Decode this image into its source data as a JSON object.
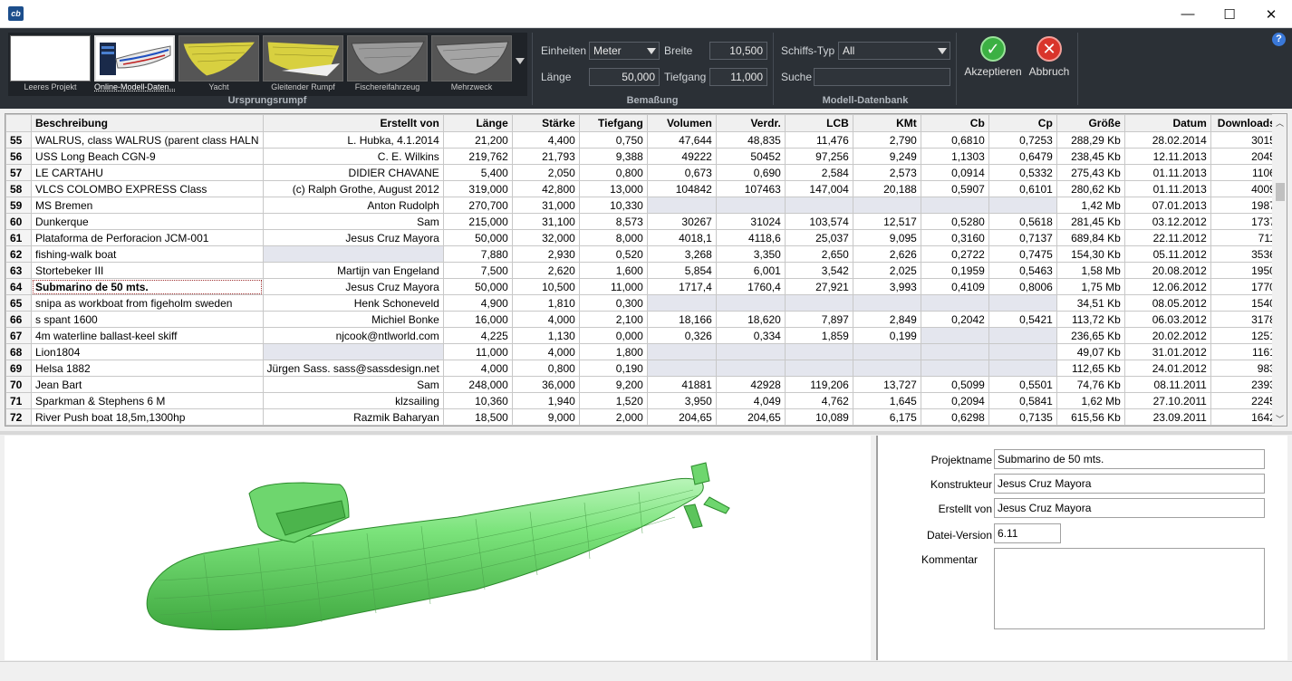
{
  "window": {
    "title_icon": "cb-logo-icon",
    "minimize": "—",
    "maximize": "☐",
    "close": "✕"
  },
  "ribbon": {
    "thumbnails": [
      {
        "label": "Leeres Projekt",
        "selected": false
      },
      {
        "label": "Online-Modell-Daten...",
        "selected": true
      },
      {
        "label": "Yacht",
        "selected": false
      },
      {
        "label": "Gleitender Rumpf",
        "selected": false
      },
      {
        "label": "Fischereifahrzeug",
        "selected": false
      },
      {
        "label": "Mehrzweck",
        "selected": false
      }
    ],
    "group_ursprung": "Ursprungsrumpf",
    "einheiten_label": "Einheiten",
    "einheiten_value": "Meter",
    "breite_label": "Breite",
    "breite_value": "10,500",
    "laenge_label": "Länge",
    "laenge_value": "50,000",
    "tiefgang_label": "Tiefgang",
    "tiefgang_value": "11,000",
    "group_bemassung": "Bemaßung",
    "schiffstyp_label": "Schiffs-Typ",
    "schiffstyp_value": "All",
    "suche_label": "Suche",
    "suche_value": "",
    "group_datenbank": "Modell-Datenbank",
    "accept_label": "Akzeptieren",
    "cancel_label": "Abbruch",
    "help_icon": "?"
  },
  "grid": {
    "columns": [
      "",
      "Beschreibung",
      "Erstellt von",
      "Länge",
      "Stärke",
      "Tiefgang",
      "Volumen",
      "Verdr.",
      "LCB",
      "KMt",
      "Cb",
      "Cp",
      "Größe",
      "Datum",
      "Downloads"
    ],
    "rows": [
      [
        "55",
        "WALRUS, class WALRUS (parent class HALN",
        "L. Hubka, 4.1.2014",
        "21,200",
        "4,400",
        "0,750",
        "47,644",
        "48,835",
        "11,476",
        "2,790",
        "0,6810",
        "0,7253",
        "288,29 Kb",
        "28.02.2014",
        "3015"
      ],
      [
        "56",
        "USS Long Beach CGN-9",
        "C. E. Wilkins",
        "219,762",
        "21,793",
        "9,388",
        "49222",
        "50452",
        "97,256",
        "9,249",
        "1,1303",
        "0,6479",
        "238,45 Kb",
        "12.11.2013",
        "2045"
      ],
      [
        "57",
        "LE CARTAHU",
        "DIDIER CHAVANE",
        "5,400",
        "2,050",
        "0,800",
        "0,673",
        "0,690",
        "2,584",
        "2,573",
        "0,0914",
        "0,5332",
        "275,43 Kb",
        "01.11.2013",
        "1106"
      ],
      [
        "58",
        "VLCS  COLOMBO EXPRESS Class",
        "(c) Ralph Grothe, August 2012",
        "319,000",
        "42,800",
        "13,000",
        "104842",
        "107463",
        "147,004",
        "20,188",
        "0,5907",
        "0,6101",
        "280,62 Kb",
        "01.11.2013",
        "4009"
      ],
      [
        "59",
        "MS Bremen",
        "Anton Rudolph",
        "270,700",
        "31,000",
        "10,330",
        "",
        "",
        "",
        "",
        "",
        "",
        "1,42 Mb",
        "07.01.2013",
        "1987"
      ],
      [
        "60",
        "Dunkerque",
        "Sam",
        "215,000",
        "31,100",
        "8,573",
        "30267",
        "31024",
        "103,574",
        "12,517",
        "0,5280",
        "0,5618",
        "281,45 Kb",
        "03.12.2012",
        "1737"
      ],
      [
        "61",
        "Plataforma de Perforacion JCM-001",
        "Jesus Cruz Mayora",
        "50,000",
        "32,000",
        "8,000",
        "4018,1",
        "4118,6",
        "25,037",
        "9,095",
        "0,3160",
        "0,7137",
        "689,84 Kb",
        "22.11.2012",
        "711"
      ],
      [
        "62",
        "fishing-walk boat",
        "",
        "7,880",
        "2,930",
        "0,520",
        "3,268",
        "3,350",
        "2,650",
        "2,626",
        "0,2722",
        "0,7475",
        "154,30 Kb",
        "05.11.2012",
        "3536"
      ],
      [
        "63",
        "Stortebeker III",
        "Martijn van Engeland",
        "7,500",
        "2,620",
        "1,600",
        "5,854",
        "6,001",
        "3,542",
        "2,025",
        "0,1959",
        "0,5463",
        "1,58 Mb",
        "20.08.2012",
        "1950"
      ],
      [
        "64",
        "Submarino de 50 mts.",
        "Jesus Cruz Mayora",
        "50,000",
        "10,500",
        "11,000",
        "1717,4",
        "1760,4",
        "27,921",
        "3,993",
        "0,4109",
        "0,8006",
        "1,75 Mb",
        "12.06.2012",
        "1770"
      ],
      [
        "65",
        "snipa as workboat from figeholm sweden",
        "Henk Schoneveld",
        "4,900",
        "1,810",
        "0,300",
        "",
        "",
        "",
        "",
        "",
        "",
        "34,51 Kb",
        "08.05.2012",
        "1540"
      ],
      [
        "66",
        "s spant 1600",
        "Michiel Bonke",
        "16,000",
        "4,000",
        "2,100",
        "18,166",
        "18,620",
        "7,897",
        "2,849",
        "0,2042",
        "0,5421",
        "113,72 Kb",
        "06.03.2012",
        "3178"
      ],
      [
        "67",
        "4m waterline ballast-keel skiff",
        "njcook@ntlworld.com",
        "4,225",
        "1,130",
        "0,000",
        "0,326",
        "0,334",
        "1,859",
        "0,199",
        "",
        "",
        "236,65 Kb",
        "20.02.2012",
        "1251"
      ],
      [
        "68",
        "Lion1804",
        "",
        "11,000",
        "4,000",
        "1,800",
        "",
        "",
        "",
        "",
        "",
        "",
        "49,07 Kb",
        "31.01.2012",
        "1161"
      ],
      [
        "69",
        "Helsa 1882",
        "Jürgen Sass. sass@sassdesign.net",
        "4,000",
        "0,800",
        "0,190",
        "",
        "",
        "",
        "",
        "",
        "",
        "112,65 Kb",
        "24.01.2012",
        "983"
      ],
      [
        "70",
        "Jean Bart",
        "Sam",
        "248,000",
        "36,000",
        "9,200",
        "41881",
        "42928",
        "119,206",
        "13,727",
        "0,5099",
        "0,5501",
        "74,76 Kb",
        "08.11.2011",
        "2393"
      ],
      [
        "71",
        "Sparkman & Stephens 6 M",
        "klzsailing",
        "10,360",
        "1,940",
        "1,520",
        "3,950",
        "4,049",
        "4,762",
        "1,645",
        "0,2094",
        "0,5841",
        "1,62 Mb",
        "27.10.2011",
        "2245"
      ],
      [
        "72",
        "River Push boat 18,5m,1300hp",
        "Razmik Baharyan",
        "18,500",
        "9,000",
        "2,000",
        "204,65",
        "204,65",
        "10,089",
        "6,175",
        "0,6298",
        "0,7135",
        "615,56 Kb",
        "23.09.2011",
        "1642"
      ]
    ],
    "selected_row": 9
  },
  "props": {
    "projektname_label": "Projektname",
    "projektname_value": "Submarino de 50 mts.",
    "konstrukteur_label": "Konstrukteur",
    "konstrukteur_value": "Jesus Cruz Mayora",
    "erstellt_label": "Erstellt von",
    "erstellt_value": "Jesus Cruz Mayora",
    "version_label": "Datei-Version",
    "version_value": "6.11",
    "kommentar_label": "Kommentar",
    "kommentar_value": ""
  },
  "colors": {
    "ribbon": "#2b3036",
    "hull_green": "#7be37b",
    "accept": "#3cb043",
    "cancel": "#d9342b"
  }
}
